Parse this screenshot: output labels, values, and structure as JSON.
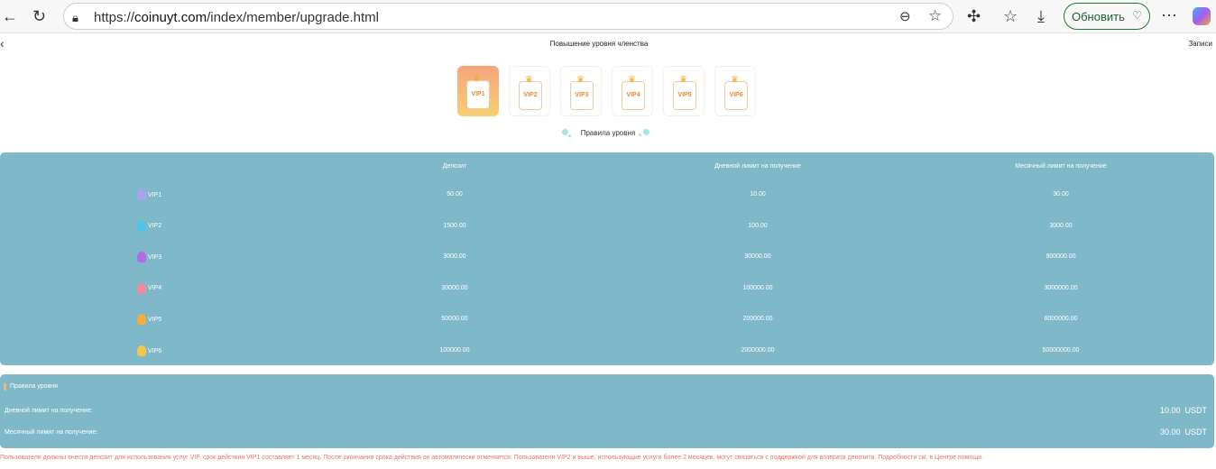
{
  "browser": {
    "url_prefix": "https://",
    "url_domain": "coinuyt.com",
    "url_path": "/index/member/upgrade.html",
    "update_label": "Обновить"
  },
  "header": {
    "title": "Повышение уровня членства",
    "records": "Записи"
  },
  "tiles": [
    {
      "label": "VIP1",
      "active": true
    },
    {
      "label": "VIP2"
    },
    {
      "label": "VIP3"
    },
    {
      "label": "VIP4"
    },
    {
      "label": "VIP5"
    },
    {
      "label": "VIP6"
    }
  ],
  "rules_label": "Правила уровня",
  "table": {
    "headers": [
      "Депозит",
      "Дневной лимит на получение",
      "Месячный лимит на получение"
    ],
    "rows": [
      {
        "level": "VIP1",
        "deposit": "50.00",
        "daily": "10.00",
        "monthly": "30.00",
        "color": "#a9a3f0"
      },
      {
        "level": "VIP2",
        "deposit": "1500.00",
        "daily": "100.00",
        "monthly": "3000.00",
        "color": "#4fc3e8"
      },
      {
        "level": "VIP3",
        "deposit": "3000.00",
        "daily": "30000.00",
        "monthly": "900000.00",
        "color": "#b36be8"
      },
      {
        "level": "VIP4",
        "deposit": "30000.00",
        "daily": "100000.00",
        "monthly": "3000000.00",
        "color": "#f08aa0"
      },
      {
        "level": "VIP5",
        "deposit": "50000.00",
        "daily": "200000.00",
        "monthly": "6000000.00",
        "color": "#f2b13a"
      },
      {
        "level": "VIP6",
        "deposit": "100000.00",
        "daily": "2000000.00",
        "monthly": "50000000.00",
        "color": "#f2c84a"
      }
    ]
  },
  "current": {
    "title": "Правила уровня",
    "daily_label": "Дневной лимит на получение:",
    "daily_value": "10.00",
    "monthly_label": "Месячный лимит на получение:",
    "monthly_value": "30.00",
    "currency": "USDT"
  },
  "footer": "Пользователи должны внести депозит для использования услуг VIP, срок действия VIP1 составляет 1 месяц. После окончания срока действия он автоматически отменяется. Пользователи VIP2 и выше, использующие услуги более 2 месяцев, могут связаться с поддержкой для возврата депозита. Подробности см. в Центре помощи."
}
